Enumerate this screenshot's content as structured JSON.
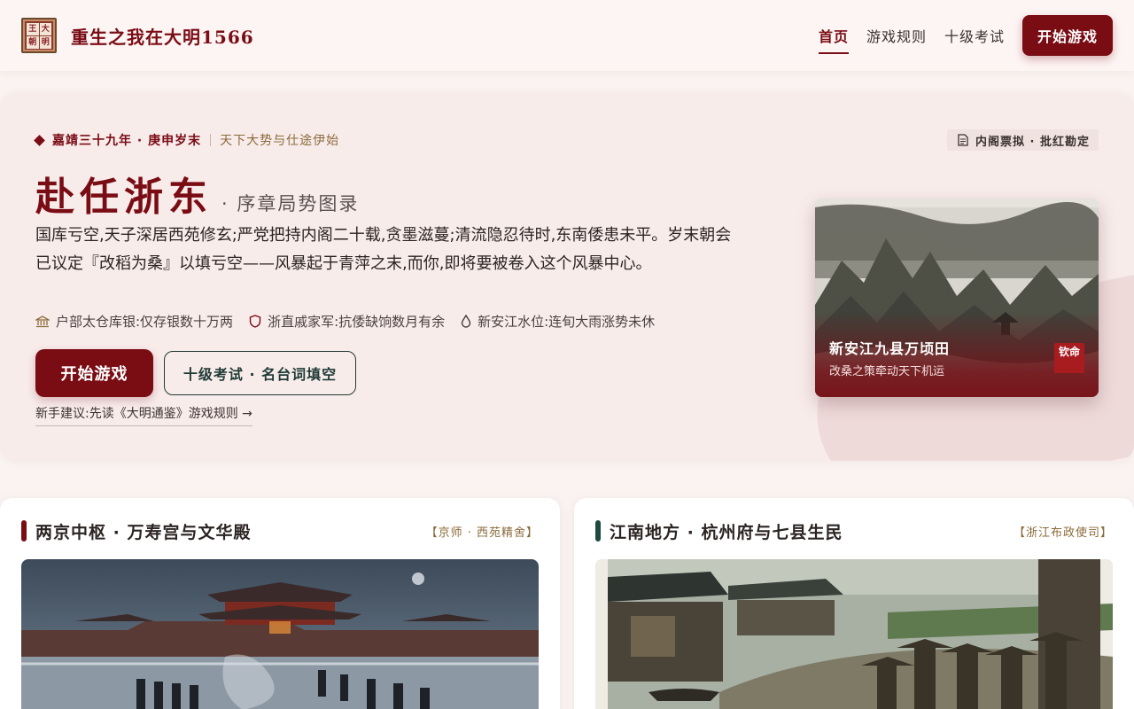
{
  "header": {
    "logo_chars": [
      "王",
      "大",
      "朝",
      "明"
    ],
    "brand": "重生之我在大明1566",
    "nav": [
      {
        "label": "首页",
        "active": true
      },
      {
        "label": "游戏规则",
        "active": false
      },
      {
        "label": "十级考试",
        "active": false
      }
    ],
    "cta": "开始游戏"
  },
  "hero": {
    "eyebrow_main": "嘉靖三十九年 · 庚申岁末",
    "eyebrow_sub": "天下大势与仕途伊始",
    "badge": "内阁票拟 · 批红勘定",
    "title": "赴任浙东",
    "subtitle": "· 序章局势图录",
    "description": "国库亏空,天子深居西苑修玄;严党把持内阁二十载,贪墨滋蔓;清流隐忍待时,东南倭患未平。岁末朝会已议定『改稻为桑』以填亏空——风暴起于青萍之末,而你,即将要被卷入这个风暴中心。",
    "stats": [
      {
        "icon": "treasury-icon",
        "text": "户部太仓库银:仅存银数十万两"
      },
      {
        "icon": "shield-icon",
        "text": "浙直戚家军:抗倭缺饷数月有余"
      },
      {
        "icon": "water-drop-icon",
        "text": "新安江水位:连旬大雨涨势未休"
      }
    ],
    "primary_button": "开始游戏",
    "secondary_button": "十级考试 · 名台词填空",
    "tip": "新手建议:先读《大明通鉴》游戏规则 →",
    "card": {
      "title": "新安江九县万顷田",
      "subtitle": "改桑之策牵动天下机运",
      "seal": "钦命"
    }
  },
  "sections": [
    {
      "title": "两京中枢 · 万寿宫与文华殿",
      "tag": "【京师 · 西苑精舍】",
      "accent": "#7a0c14"
    },
    {
      "title": "江南地方 · 杭州府与七县生民",
      "tag": "【浙江布政使司】",
      "accent": "#1f4a40"
    }
  ],
  "colors": {
    "primary": "#7a0c14",
    "accent_dark_green": "#1f3a35",
    "gold_text": "#8a6a3a",
    "background": "#faf3f1"
  }
}
